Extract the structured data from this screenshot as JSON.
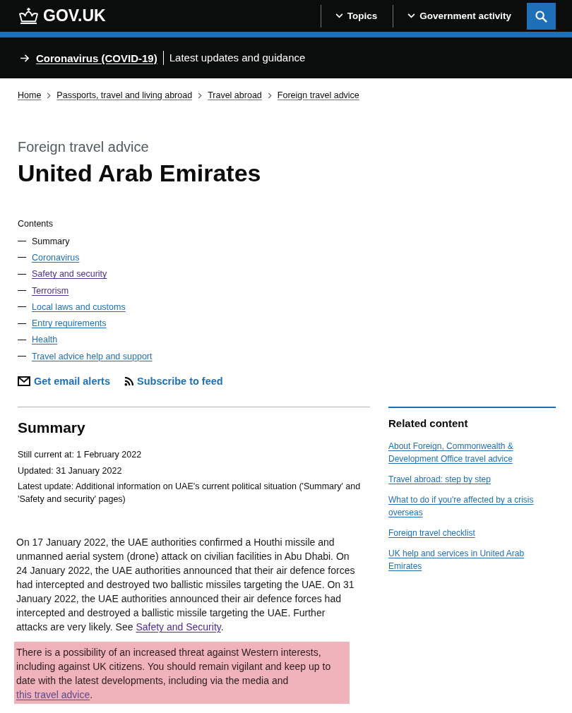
{
  "header": {
    "logo": "GOV.UK",
    "nav": [
      {
        "label": "Topics"
      },
      {
        "label": "Government activity"
      }
    ]
  },
  "banner": {
    "link": "Coronavirus (COVID-19)",
    "text": "Latest updates and guidance"
  },
  "breadcrumbs": [
    "Home",
    "Passports, travel and living abroad",
    "Travel abroad",
    "Foreign travel advice"
  ],
  "page": {
    "caption": "Foreign travel advice",
    "title": "United Arab Emirates"
  },
  "contents": {
    "heading": "Contents",
    "items": [
      {
        "label": "Summary",
        "selected": true,
        "visited": false
      },
      {
        "label": "Coronavirus",
        "selected": false,
        "visited": false
      },
      {
        "label": "Safety and security",
        "selected": false,
        "visited": true
      },
      {
        "label": "Terrorism",
        "selected": false,
        "visited": true
      },
      {
        "label": "Local laws and customs",
        "selected": false,
        "visited": false
      },
      {
        "label": "Entry requirements",
        "selected": false,
        "visited": false
      },
      {
        "label": "Health",
        "selected": false,
        "visited": false
      },
      {
        "label": "Travel advice help and support",
        "selected": false,
        "visited": false
      }
    ]
  },
  "subscriptions": [
    {
      "kind": "email",
      "label": "Get email alerts"
    },
    {
      "kind": "feed",
      "label": "Subscribe to feed"
    }
  ],
  "summary": {
    "heading": "Summary",
    "meta": [
      "Still current at: 1 February 2022",
      "Updated: 31 January 2022",
      "Latest update: Additional information on UAE's current political situation ('Summary' and 'Safety and security' pages)"
    ],
    "paragraphs": [
      {
        "text": "On 17 January 2022, the UAE authorities confirmed a Houthi missile and unmanned aerial system (drone) attack on civilian facilities in Abu Dhabi. On 24 January 2022, the UAE authorities announced that their air defence forces had intercepted and destroyed two ballistic missiles targeting the UAE. On 31 January 2022, the UAE authorities announced their air defence forces had intercepted and destroyed a ballistic missile targeting the UAE. Further attacks are very likely. See ",
        "link": "Safety and Security",
        "after": ".",
        "link_visited": true,
        "highlighted": false
      },
      {
        "text": "There is a possibility of an increased threat against Western interests, including against UK citizens. You should remain vigilant and keep up to date with the latest developments, including via the media and ",
        "link": "this travel advice",
        "after": ".",
        "link_visited": true,
        "highlighted": true
      }
    ]
  },
  "related": {
    "heading": "Related content",
    "links": [
      "About Foreign, Commonwealth & Development Office travel advice",
      "Travel abroad: step by step",
      "What to do if you're affected by a crisis overseas",
      "Foreign travel checklist",
      "UK help and services in United Arab Emirates"
    ]
  }
}
